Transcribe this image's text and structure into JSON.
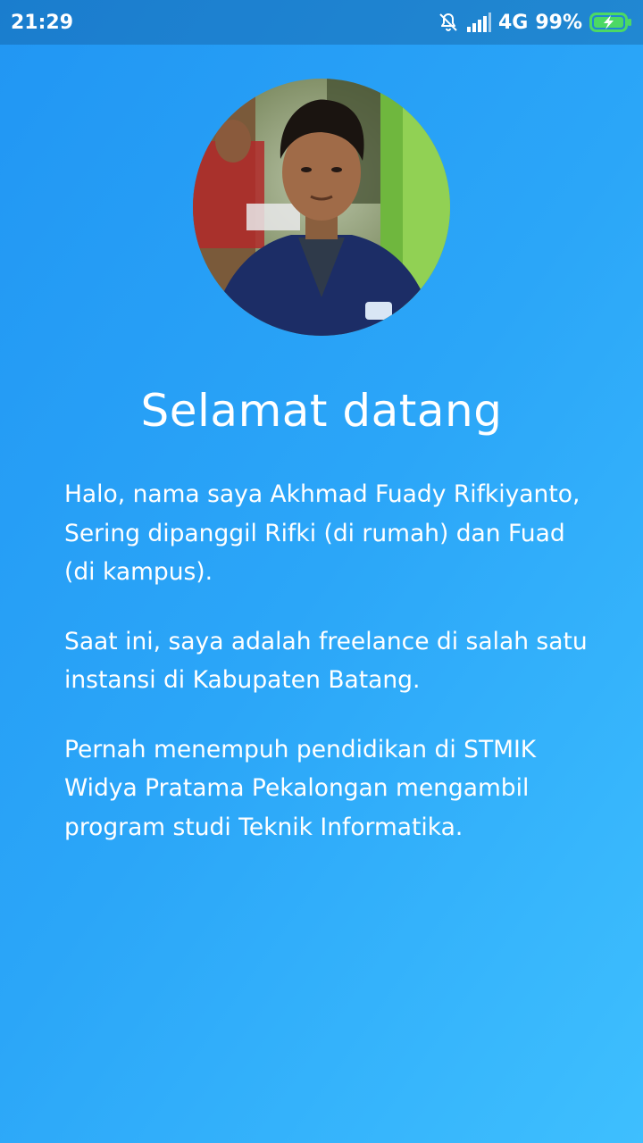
{
  "status_bar": {
    "time": "21:29",
    "network": "4G",
    "battery": "99%"
  },
  "icons": {
    "silent": "bell-off-icon",
    "signal": "signal-bars-icon",
    "battery": "battery-charging-icon"
  },
  "colors": {
    "gradient_start": "#2196F3",
    "gradient_end": "#3EBFFE",
    "text": "#FFFFFF",
    "battery": "#4CD964"
  },
  "profile": {
    "title": "Selamat datang",
    "paragraphs": [
      "Halo, nama saya Akhmad Fuady Rifkiyanto, Sering dipanggil Rifki (di rumah) dan Fuad (di kampus).",
      "Saat ini, saya adalah freelance di salah satu instansi di Kabupaten Batang.",
      "Pernah menempuh pendidikan di STMIK Widya Pratama Pekalongan mengambil program studi Teknik Informatika."
    ]
  }
}
